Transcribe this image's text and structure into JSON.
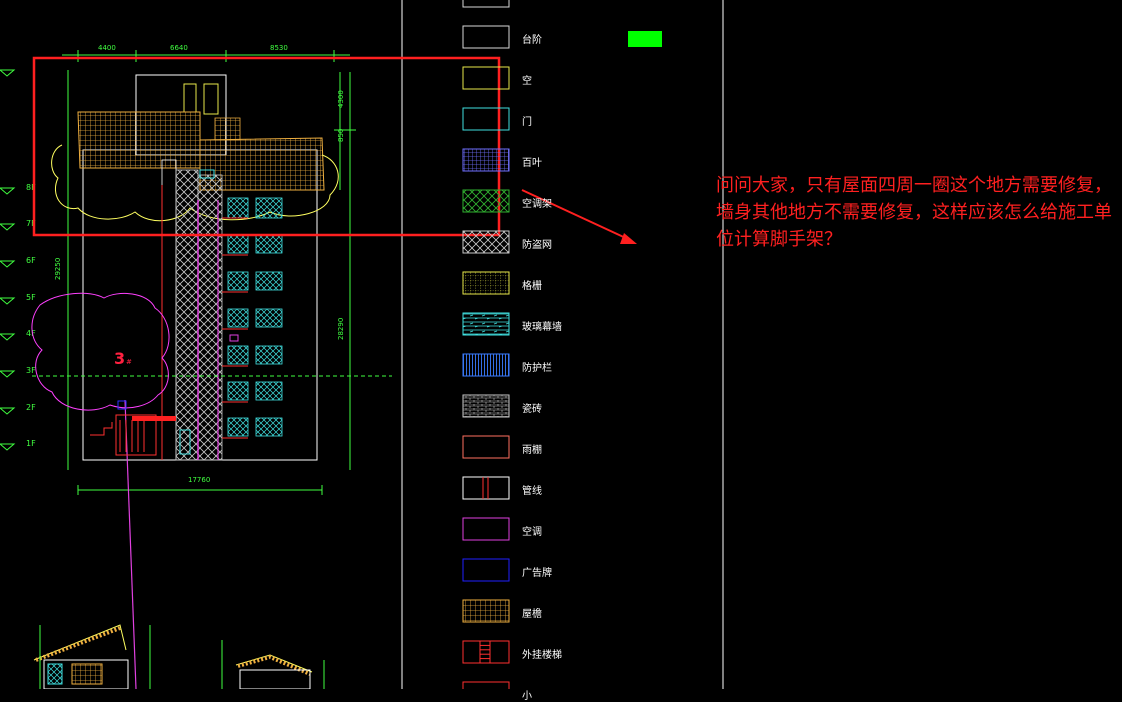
{
  "drawing": {
    "dims_top": [
      "4400",
      "6640",
      "8530"
    ],
    "dim_bottom": "17760",
    "dims_left": [
      "29250"
    ],
    "dims_right": [
      "4300",
      "850",
      "28290"
    ],
    "floor_labels": [
      "8F",
      "7F",
      "6F",
      "5F",
      "4F",
      "3F",
      "2F",
      "1F"
    ],
    "tag": "3",
    "tag_suffix": "#"
  },
  "legend": {
    "items": [
      {
        "label": "台阶",
        "style": "plain",
        "color": "#d8d8d8"
      },
      {
        "label": "空",
        "style": "plain",
        "color": "#e8e84a"
      },
      {
        "label": "门",
        "style": "plain",
        "color": "#40e0e0"
      },
      {
        "label": "百叶",
        "style": "grid",
        "color": "#7070ff"
      },
      {
        "label": "空调架",
        "style": "cross",
        "color": "#30b030"
      },
      {
        "label": "防盗网",
        "style": "cross",
        "color": "#c8c8c8"
      },
      {
        "label": "格栅",
        "style": "dots",
        "color": "#e8e84a"
      },
      {
        "label": "玻璃幕墙",
        "style": "glass",
        "color": "#40e0e0"
      },
      {
        "label": "防护栏",
        "style": "vlines",
        "color": "#3a7bff"
      },
      {
        "label": "瓷砖",
        "style": "brick",
        "color": "#c8c8c8"
      },
      {
        "label": "雨棚",
        "style": "plain",
        "color": "#ff7060"
      },
      {
        "label": "管线",
        "style": "pipe",
        "color": "#ffffff"
      },
      {
        "label": "空调",
        "style": "plain",
        "color": "#e040e0"
      },
      {
        "label": "广告牌",
        "style": "plain",
        "color": "#2020ff"
      },
      {
        "label": "屋檐",
        "style": "roof",
        "color": "#f0b040"
      },
      {
        "label": "外挂楼梯",
        "style": "stair",
        "color": "#ff3030"
      },
      {
        "label": "小",
        "style": "plain",
        "color": "#ff3030"
      }
    ]
  },
  "annotation": {
    "text": "问问大家，只有屋面四周一圈这个地方需要修复，墙身其他地方不需要修复，这样应该怎么给施工单位计算脚手架？"
  },
  "colors": {
    "background": "#000000",
    "highlight_box": "#ff2020",
    "dimension": "#40ff40",
    "swatch": "#00ff00",
    "building_outline": "#ffffff",
    "tree": "#ff40ff",
    "tree_top": "#ffff60"
  }
}
